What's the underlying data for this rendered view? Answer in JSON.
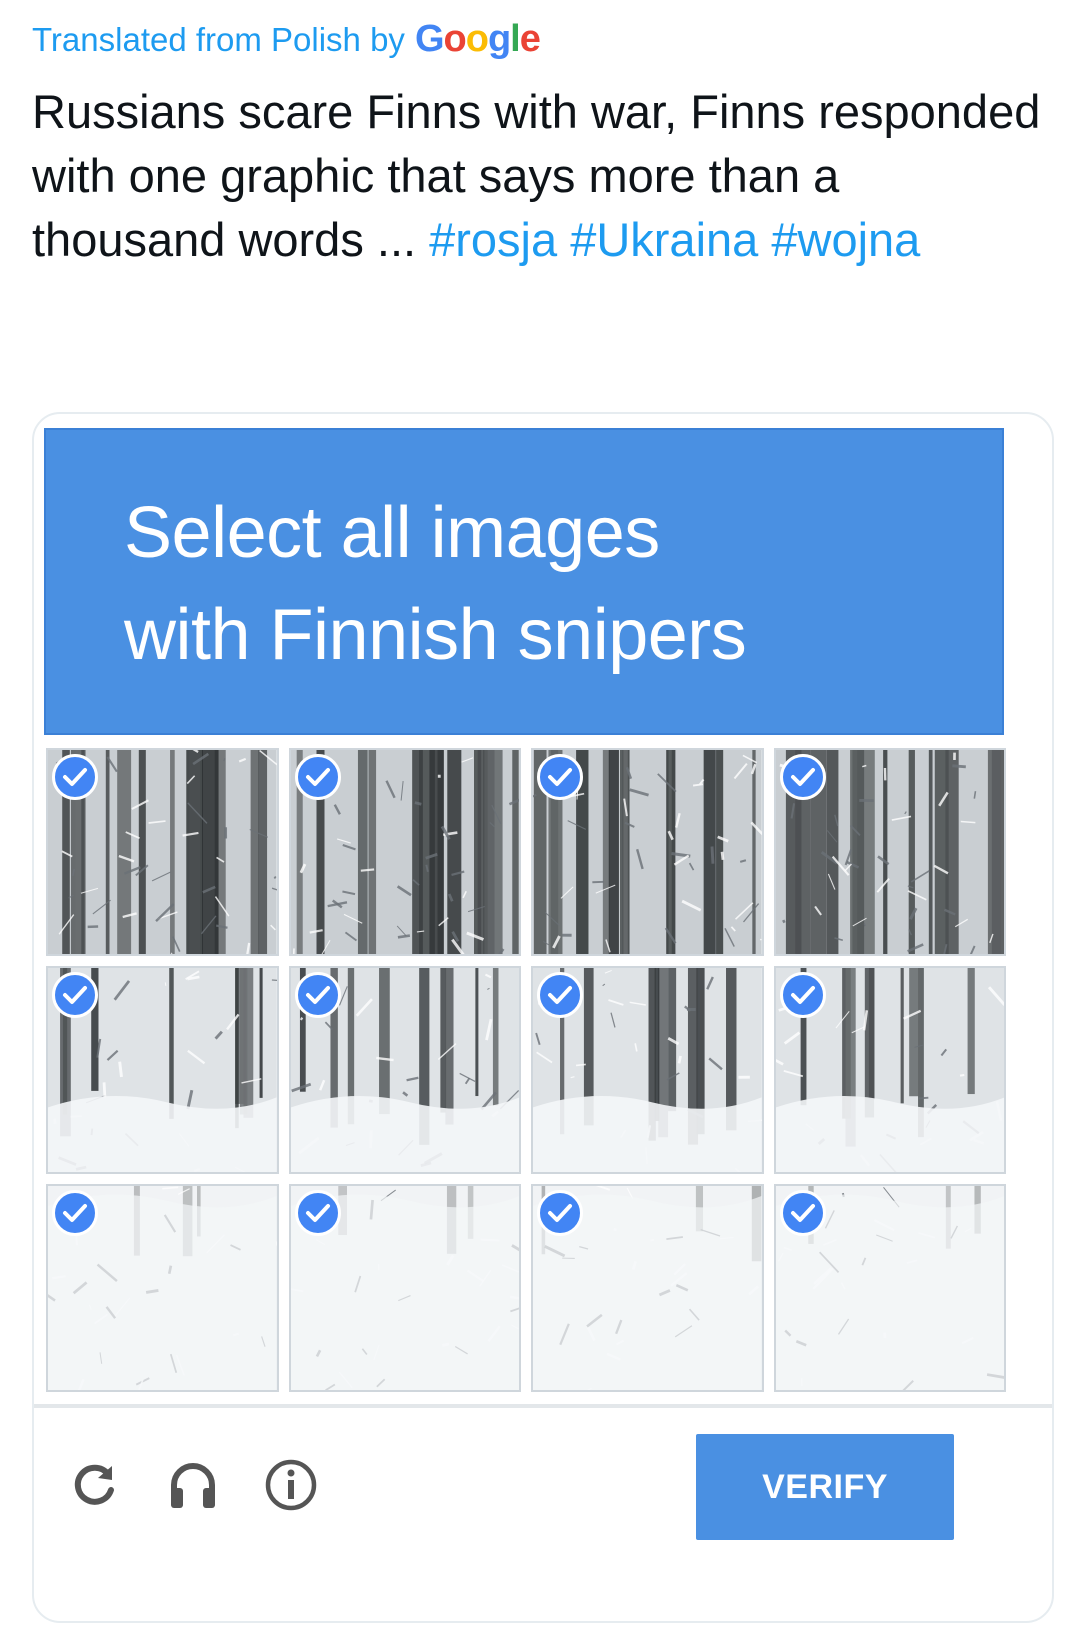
{
  "translation": {
    "prefix": "Translated from Polish by",
    "brand": {
      "G": "G",
      "o1": "o",
      "o2": "o",
      "g": "g",
      "l": "l",
      "e": "e"
    }
  },
  "tweet": {
    "text": "Russians scare Finns with war, Finns responded with one graphic that says more than a thousand words ...",
    "hashtags": [
      "#rosja",
      "#Ukraina",
      "#wojna"
    ]
  },
  "captcha": {
    "header_line1": "Select all images",
    "header_line2": "with Finnish snipers",
    "tiles_selected": [
      true,
      true,
      true,
      true,
      true,
      true,
      true,
      true,
      true,
      true,
      true,
      true
    ],
    "verify_label": "VERIFY",
    "icons": [
      "reload-icon",
      "headphones-icon",
      "info-icon"
    ],
    "colors": {
      "header": "#4a90e2",
      "check": "#4285f4",
      "link": "#1d9bf0"
    }
  }
}
